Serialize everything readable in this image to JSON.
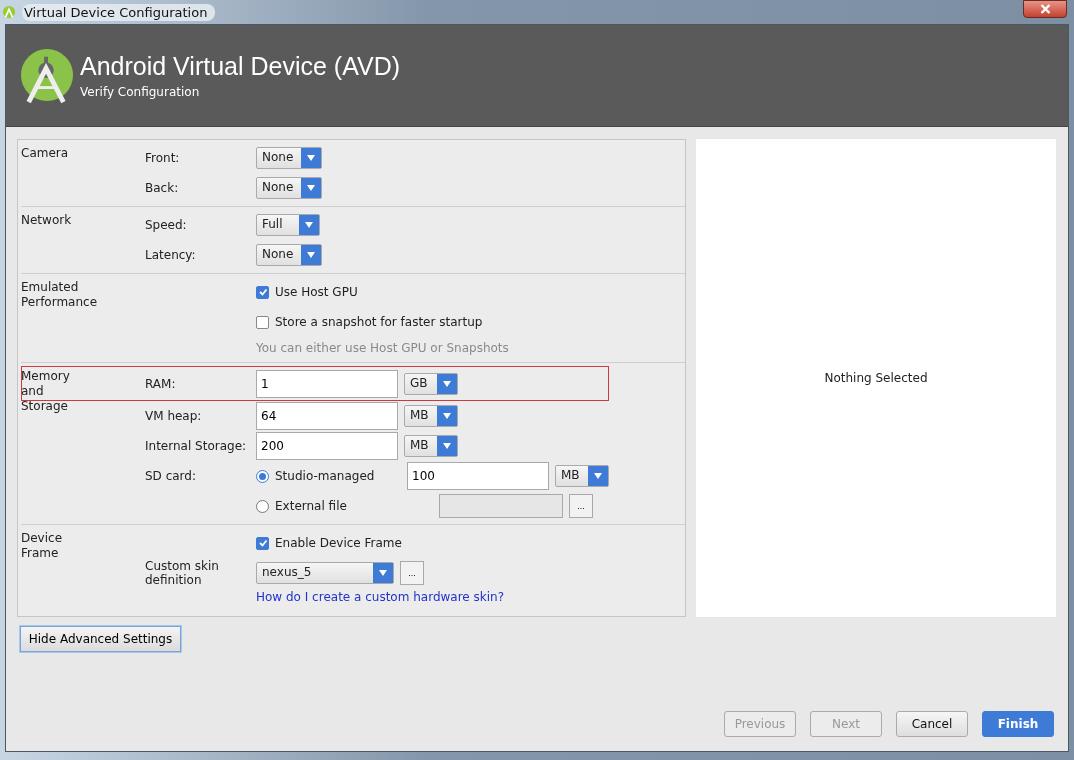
{
  "window": {
    "title": "Virtual Device Configuration"
  },
  "header": {
    "title": "Android Virtual Device (AVD)",
    "subtitle": "Verify Configuration"
  },
  "sections": [
    {
      "label": "Camera",
      "rows": [
        {
          "kind": "select",
          "label": "Front:",
          "value": "None"
        },
        {
          "kind": "select",
          "label": "Back:",
          "value": "None"
        }
      ]
    },
    {
      "label": "Network",
      "rows": [
        {
          "kind": "select",
          "label": "Speed:",
          "value": "Full"
        },
        {
          "kind": "select",
          "label": "Latency:",
          "value": "None"
        }
      ]
    },
    {
      "label": "Emulated Performance",
      "rows": [
        {
          "kind": "checkbox",
          "text": "Use Host GPU",
          "checked": true
        },
        {
          "kind": "checkbox",
          "text": "Store a snapshot for faster startup",
          "checked": false
        },
        {
          "kind": "hint",
          "text": "You can either use Host GPU or Snapshots"
        }
      ]
    },
    {
      "label": "Memory and Storage",
      "rows": [
        {
          "kind": "size",
          "label": "RAM:",
          "value": "1",
          "unit": "GB",
          "highlighted": true
        },
        {
          "kind": "size",
          "label": "VM heap:",
          "value": "64",
          "unit": "MB",
          "highlighted": false
        },
        {
          "kind": "size",
          "label": "Internal Storage:",
          "value": "200",
          "unit": "MB",
          "highlighted": false
        },
        {
          "kind": "radio",
          "label": "SD card:",
          "text": "Studio-managed",
          "selected": true,
          "value": "100",
          "unit": "MB"
        },
        {
          "kind": "radio",
          "text": "External file",
          "selected": false,
          "browse": "..."
        }
      ]
    },
    {
      "label": "Device Frame",
      "rows": [
        {
          "kind": "checkbox",
          "text": "Enable Device Frame",
          "checked": true
        },
        {
          "kind": "skin",
          "label": "Custom skin definition",
          "value": "nexus_5",
          "browse": "..."
        },
        {
          "kind": "link",
          "text": "How do I create a custom hardware skin?"
        }
      ]
    }
  ],
  "preview": {
    "text": "Nothing Selected"
  },
  "advanced_button": "Hide Advanced Settings",
  "footer": [
    {
      "label": "Previous",
      "disabled": true,
      "primary": false
    },
    {
      "label": "Next",
      "disabled": true,
      "primary": false
    },
    {
      "label": "Cancel",
      "disabled": false,
      "primary": false
    },
    {
      "label": "Finish",
      "disabled": false,
      "primary": true
    }
  ]
}
